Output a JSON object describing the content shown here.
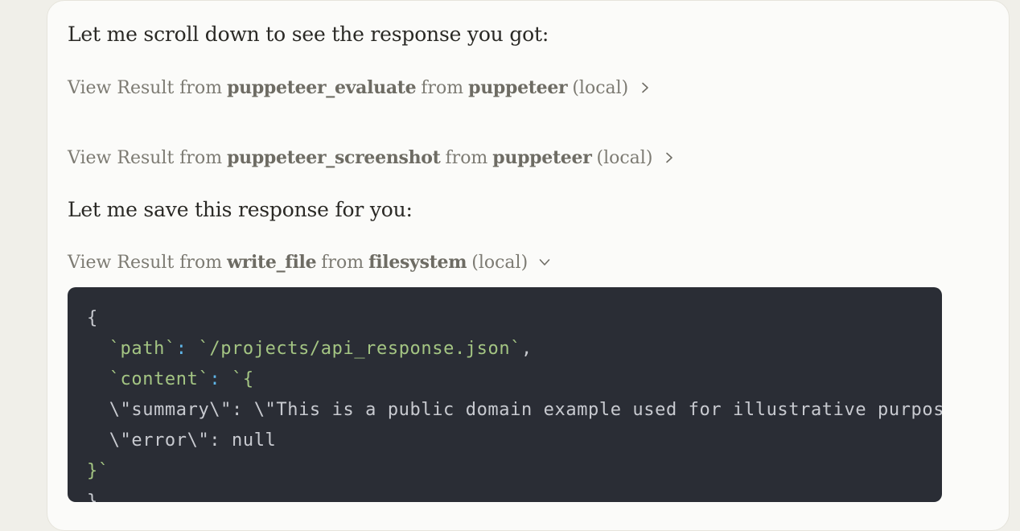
{
  "messages": {
    "scroll_text": "Let me scroll down to see the response you got:",
    "save_text": "Let me save this response for you:"
  },
  "tool_results": [
    {
      "prefix": "View Result from",
      "tool": "puppeteer_evaluate",
      "from": "from",
      "server": "puppeteer",
      "scope": "(local)",
      "state": "collapsed"
    },
    {
      "prefix": "View Result from",
      "tool": "puppeteer_screenshot",
      "from": "from",
      "server": "puppeteer",
      "scope": "(local)",
      "state": "collapsed"
    },
    {
      "prefix": "View Result from",
      "tool": "write_file",
      "from": "from",
      "server": "filesystem",
      "scope": "(local)",
      "state": "expanded"
    }
  ],
  "code": {
    "l1": "{",
    "l2_key": "`path`",
    "l2_colon": ":",
    "l2_val": "`/projects/api_response.json`",
    "l2_comma": ",",
    "l3_key": "`content`",
    "l3_colon": ":",
    "l3_val": "`{",
    "l4": "\\\"summary\\\": \\\"This is a public domain example used for illustrative purposes",
    "l5": "\\\"error\\\": null",
    "l6": "}`",
    "l7": "}"
  },
  "colors": {
    "code_bg": "#2a2d35",
    "string_green": "#a4c583",
    "punct_blue": "#5fb6e9",
    "page_bg": "#f0efe9"
  }
}
